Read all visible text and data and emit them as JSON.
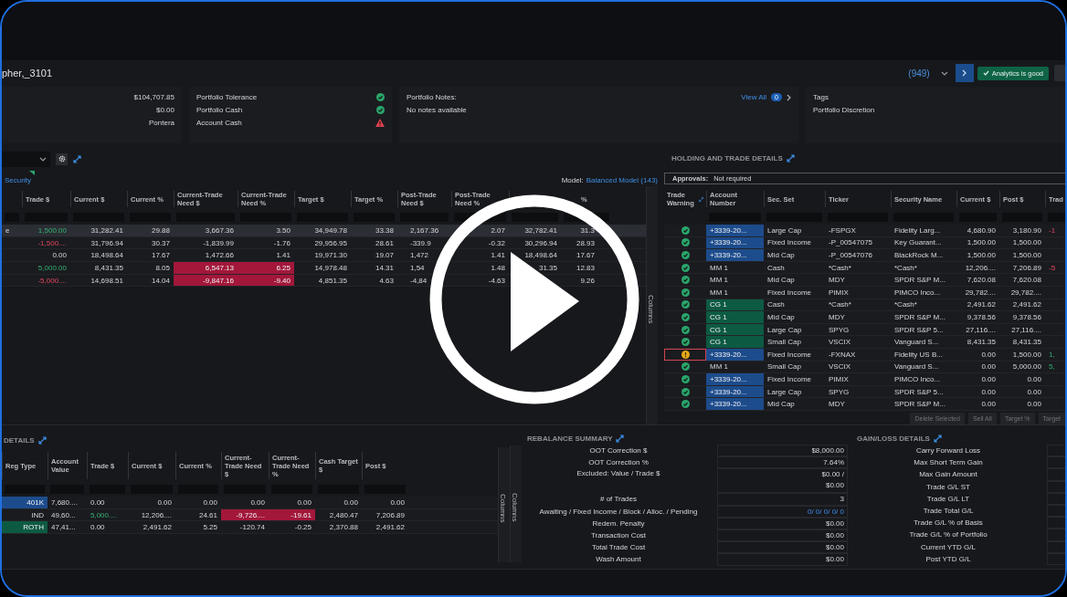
{
  "header": {
    "title": "pher,_3101",
    "count": "(949)",
    "status": "Analytics is good"
  },
  "summary": {
    "amounts": [
      "$104,707.85",
      "$0.00",
      "Pontera"
    ],
    "checks": [
      {
        "label": "Portfolio Tolerance",
        "passed": true
      },
      {
        "label": "Portfolio Cash",
        "passed": true
      },
      {
        "label": "Account Cash",
        "passed": false
      }
    ],
    "notes": {
      "title": "Portfolio Notes:",
      "text": "No notes available",
      "link": "View All",
      "count": "0"
    },
    "tags": {
      "title": "Tags",
      "items": [
        "Portfolio Discretion"
      ]
    }
  },
  "security_table": {
    "tab": "Security",
    "model_label": "Model:",
    "model": "Balanced Model (143)",
    "side_tab": "Columns",
    "columns": [
      null,
      "Trade $",
      "Current $",
      "Current %",
      "Current-Trade Need $",
      "Current-Trade Need %",
      "Target $",
      "Target %",
      "Post-Trade Need $",
      "Post-Trade Need %",
      null,
      "%"
    ],
    "rows": [
      {
        "selected": true,
        "cells": [
          "e",
          {
            "text": "1,500.00",
            "kind": "positive"
          },
          "31,282.41",
          "29.88",
          "3,667.36",
          "3.50",
          "34,949.78",
          "33.38",
          "2,167.36",
          "2.07",
          "32,782.41",
          "31.3"
        ]
      },
      {
        "selected": false,
        "cells": [
          null,
          {
            "text": "-1,500....",
            "kind": "negative"
          },
          "31,796.94",
          "30.37",
          "-1,839.99",
          "-1.76",
          "29,956.95",
          "28.61",
          "-339.9",
          "-0.32",
          "30,296.94",
          "28.93"
        ]
      },
      {
        "selected": false,
        "cells": [
          null,
          "0.00",
          "18,498.64",
          "17.67",
          "1,472.66",
          "1.41",
          "19,971.30",
          "19.07",
          "1,472",
          "1.41",
          "18,498.64",
          "17.67"
        ]
      },
      {
        "selected": false,
        "cells": [
          null,
          {
            "text": "5,000.00",
            "kind": "positive"
          },
          "8,431.35",
          "8.05",
          {
            "text": "6,547.13",
            "color": "#a3173a"
          },
          {
            "text": "6.25",
            "color": "#a3173a"
          },
          "14,978.48",
          "14.31",
          "1,54",
          "1.48",
          "31.35",
          "12.83"
        ]
      },
      {
        "selected": false,
        "cells": [
          null,
          {
            "text": "-5,000....",
            "kind": "negative"
          },
          "14,698.51",
          "14.04",
          {
            "text": "-9,847.16",
            "color": "#a3173a"
          },
          {
            "text": "-9.40",
            "color": "#a3173a"
          },
          "4,851.35",
          "4.63",
          "-4,84",
          "-4.63",
          null,
          "9.26"
        ]
      }
    ]
  },
  "holding": {
    "title": "HOLDING AND TRADE DETAILS",
    "approvals_label": "Approvals:",
    "approvals": "Not required",
    "columns": [
      "Trade Warning",
      "Account Number",
      "Sec. Set",
      "Ticker",
      "Security Name",
      "Current $",
      "Post $",
      "Trad"
    ],
    "rows": [
      {
        "cells": [
          {
            "warning": false,
            "focused": false
          },
          {
            "text": "+3339-20...",
            "color": "#1d4c8c"
          },
          "Large Cap",
          "-FSPGX",
          "Fidelity Larg...",
          "4,680.90",
          "3,180.90",
          {
            "text": "-1",
            "kind": "negative"
          }
        ]
      },
      {
        "cells": [
          {
            "warning": false,
            "focused": false
          },
          {
            "text": "+3339-20...",
            "color": "#1d4c8c"
          },
          "Fixed Income",
          "-P_00547075",
          "Key Guarant...",
          "1,500.00",
          "1,500.00",
          null
        ]
      },
      {
        "cells": [
          {
            "warning": false,
            "focused": false
          },
          {
            "text": "+3339-20...",
            "color": "#1d4c8c"
          },
          "Mid Cap",
          "-P_00547076",
          "BlackRock M...",
          "1,500.00",
          "1,500.00",
          null
        ]
      },
      {
        "cells": [
          {
            "warning": false,
            "focused": false
          },
          "MM 1",
          "Cash",
          "*Cash*",
          "*Cash*",
          "12,206....",
          "7,206.89",
          {
            "text": "-5",
            "kind": "negative"
          }
        ]
      },
      {
        "cells": [
          {
            "warning": false,
            "focused": false
          },
          "MM 1",
          "Mid Cap",
          "MDY",
          "SPDR S&P M...",
          "7,620.08",
          "7,620.08",
          null
        ]
      },
      {
        "cells": [
          {
            "warning": false,
            "focused": false
          },
          "MM 1",
          "Fixed Income",
          "PIMIX",
          "PIMCO Inco...",
          "29,782....",
          "29,782....",
          null
        ]
      },
      {
        "cells": [
          {
            "warning": false,
            "focused": false
          },
          {
            "text": "CG 1",
            "color": "#0d5a43"
          },
          "Cash",
          "*Cash*",
          "*Cash*",
          "2,491.62",
          "2,491.62",
          null
        ]
      },
      {
        "cells": [
          {
            "warning": false,
            "focused": false
          },
          {
            "text": "CG 1",
            "color": "#0d5a43"
          },
          "Mid Cap",
          "MDY",
          "SPDR S&P M...",
          "9,378.56",
          "9,378.56",
          null
        ]
      },
      {
        "cells": [
          {
            "warning": false,
            "focused": false
          },
          {
            "text": "CG 1",
            "color": "#0d5a43"
          },
          "Large Cap",
          "SPYG",
          "SPDR S&P 5...",
          "27,116....",
          "27,116....",
          null
        ]
      },
      {
        "cells": [
          {
            "warning": false,
            "focused": false
          },
          {
            "text": "CG 1",
            "color": "#0d5a43"
          },
          "Small Cap",
          "VSCIX",
          "Vanguard S...",
          "8,431.35",
          "8,431.35",
          null
        ]
      },
      {
        "cells": [
          {
            "warning": true,
            "focused": true
          },
          {
            "text": "+3339-20...",
            "color": "#1d4c8c"
          },
          "Fixed Income",
          "-FXNAX",
          "Fidelity US B...",
          "0.00",
          "1,500.00",
          {
            "text": "1,",
            "kind": "positive"
          }
        ]
      },
      {
        "cells": [
          {
            "warning": false,
            "focused": false
          },
          "MM 1",
          "Small Cap",
          "VSCIX",
          "Vanguard S...",
          "0.00",
          "5,000.00",
          {
            "text": "5,",
            "kind": "positive"
          }
        ]
      },
      {
        "cells": [
          {
            "warning": false,
            "focused": false
          },
          {
            "text": "+3339-20...",
            "color": "#1d4c8c"
          },
          "Fixed Income",
          "PIMIX",
          "PIMCO Inco...",
          "0.00",
          "0.00",
          null
        ]
      },
      {
        "cells": [
          {
            "warning": false,
            "focused": false
          },
          {
            "text": "+3339-20...",
            "color": "#1d4c8c"
          },
          "Large Cap",
          "SPYG",
          "SPDR S&P 5...",
          "0.00",
          "0.00",
          null
        ]
      },
      {
        "cells": [
          {
            "warning": false,
            "focused": false
          },
          {
            "text": "+3339-20...",
            "color": "#1d4c8c"
          },
          "Mid Cap",
          "MDY",
          "SPDR S&P M...",
          "0.00",
          "0.00",
          null
        ]
      }
    ],
    "buttons": [
      "Delete Selected",
      "Sell All",
      "Target %",
      "Target"
    ]
  },
  "account_details": {
    "title": "DETAILS",
    "side_tab": "Columns",
    "columns": [
      "Reg Type",
      "Account Value",
      "Trade $",
      "Current $",
      "Current %",
      "Current-Trade Need $",
      "Current-Trade Need %",
      "Cash Target $",
      "Post $"
    ],
    "rows": [
      {
        "cells": [
          {
            "text": "401K",
            "color": "#1d4c8c"
          },
          "7,680....",
          "0.00",
          "0.00",
          "0.00",
          "0.00",
          "0.00",
          "0.00",
          "0.00"
        ]
      },
      {
        "cells": [
          "IND",
          "49,60...",
          {
            "text": "5,000....",
            "kind": "positive"
          },
          "12,206....",
          "24.61",
          {
            "text": "-9,726....",
            "color": "#a3173a"
          },
          {
            "text": "-19.61",
            "color": "#a3173a"
          },
          "2,480.47",
          "7,206.89"
        ]
      },
      {
        "cells": [
          {
            "text": "ROTH",
            "color": "#0d5a43"
          },
          "47,41...",
          "0.00",
          "2,491.62",
          "5.25",
          "-120.74",
          "-0.25",
          "2,370.88",
          "2,491.62"
        ]
      }
    ]
  },
  "rebalance_summary": {
    "title": "REBALANCE SUMMARY",
    "side_tab": "Columns",
    "rows": [
      {
        "label": "OOT Correction $",
        "value": "$8,000.00"
      },
      {
        "label": "OOT Correction %",
        "value": "7.64%"
      },
      {
        "label": "Excluded: Value / Trade $",
        "value": [
          "$0.00 /",
          "$0.00"
        ]
      },
      {
        "label": "# of Trades",
        "value": "3"
      },
      {
        "label": "Awaiting / Fixed Income / Block / Alloc. / Pending",
        "value": {
          "text": "0/ 0/ 0/ 0/ 0",
          "kind": "link"
        }
      },
      {
        "label": "Redem. Penalty",
        "value": "$0.00"
      },
      {
        "label": "Transaction Cost",
        "value": "$0.00"
      },
      {
        "label": "Total Trade Cost",
        "value": "$0.00"
      },
      {
        "label": "Wash Amount",
        "value": "$0.00"
      }
    ]
  },
  "gain_loss": {
    "title": "GAIN/LOSS DETAILS",
    "labels": [
      "Carry Forward Loss",
      "Max Short Term Gain",
      "Max Gain Amount",
      "Trade G/L ST",
      "Trade G/L LT",
      "Trade Total G/L",
      "Trade G/L % of Basis",
      "Trade G/L % of Portfolio",
      "Current YTD G/L",
      "Post YTD G/L"
    ]
  }
}
